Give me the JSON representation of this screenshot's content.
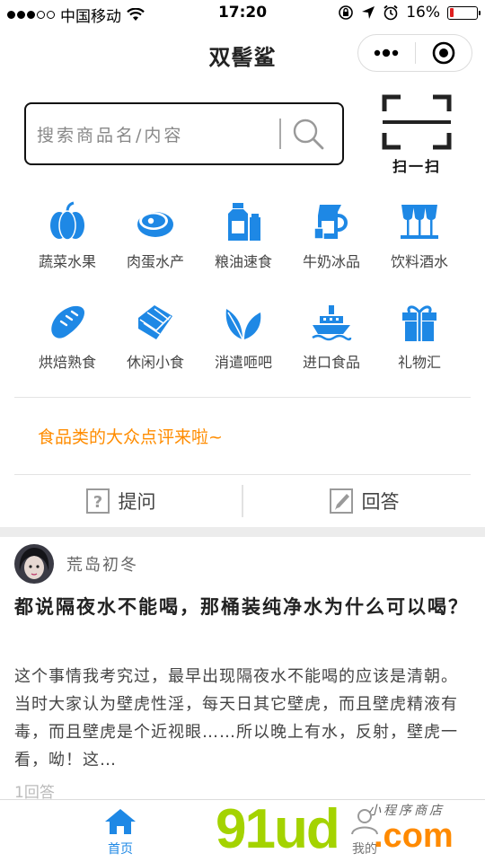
{
  "status_bar": {
    "carrier": "中国移动",
    "time": "17:20",
    "battery_text": "16%",
    "battery_level": 0.16,
    "signal_bars": 3
  },
  "nav": {
    "title": "双髻鲨"
  },
  "search": {
    "placeholder": "搜索商品名/内容"
  },
  "scan": {
    "label": "扫一扫"
  },
  "categories": [
    {
      "label": "蔬菜水果",
      "icon": "pumpkin-icon"
    },
    {
      "label": "肉蛋水产",
      "icon": "meat-icon"
    },
    {
      "label": "粮油速食",
      "icon": "oil-bottle-icon"
    },
    {
      "label": "牛奶冰品",
      "icon": "milk-jug-icon"
    },
    {
      "label": "饮料酒水",
      "icon": "wine-glass-icon"
    },
    {
      "label": "烘焙熟食",
      "icon": "bread-icon"
    },
    {
      "label": "休闲小食",
      "icon": "chocolate-icon"
    },
    {
      "label": "消遣咂吧",
      "icon": "leaf-icon"
    },
    {
      "label": "进口食品",
      "icon": "ship-icon"
    },
    {
      "label": "礼物汇",
      "icon": "gift-icon"
    }
  ],
  "promo": {
    "text": "食品类的大众点评来啦~"
  },
  "qa": {
    "ask_label": "提问",
    "answer_label": "回答"
  },
  "post": {
    "username": "荒岛初冬",
    "title": "都说隔夜水不能喝，那桶装纯净水为什么可以喝？",
    "body": "这个事情我考究过，最早出现隔夜水不能喝的应该是清朝。当时大家认为壁虎性淫，每天日其它壁虎，而且壁虎精液有毒，而且壁虎是个近视眼……所以晚上有水，反射，壁虎一看，呦！这…",
    "answer_count": "1回答"
  },
  "tabbar": {
    "home_label": "首页",
    "mine_label": "我的"
  },
  "watermark": {
    "main": "91ud",
    "com": ".com",
    "script": "小程序商店"
  },
  "colors": {
    "accent_blue": "#1e88e5",
    "promo_orange": "#ff8c00",
    "battery_red": "#e02020"
  }
}
